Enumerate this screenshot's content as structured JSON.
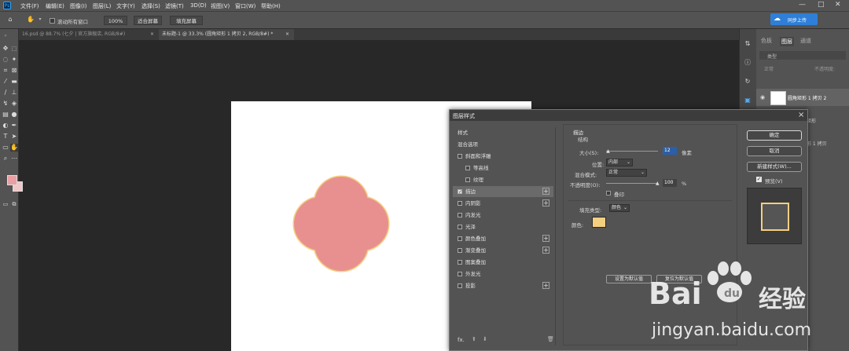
{
  "menubar": {
    "logo": "Ps",
    "items": [
      "文件(F)",
      "编辑(E)",
      "图像(I)",
      "图层(L)",
      "文字(Y)",
      "选择(S)",
      "滤镜(T)",
      "3D(D)",
      "视图(V)",
      "窗口(W)",
      "帮助(H)"
    ],
    "minimize": "—",
    "maximize": "□",
    "close": "✕",
    "cloud_button": "同步上传"
  },
  "options": {
    "scroll_all_windows": "滚动所有窗口",
    "zoom_100": "100%",
    "fit_screen": "适合屏幕",
    "fill_screen": "填充屏幕"
  },
  "tabs": [
    {
      "label": "16.psd @ 88.7% (七夕 | 官方旗舰店, RGB/8#)",
      "close": "×"
    },
    {
      "label": "未标题-1 @ 33.3% (圆角矩形 1 拷贝 2, RGB/8#) *",
      "close": "×"
    }
  ],
  "panel": {
    "tabs": [
      "色板",
      "图层",
      "通道"
    ],
    "kind_label": "类型",
    "blend_label": "正常",
    "opacity_label": "不透明度:",
    "layers": [
      "圆角矩形 1 拷贝 2",
      "矩形",
      "形 1 拷贝"
    ]
  },
  "dialog": {
    "title": "图层样式",
    "close": "×",
    "style_list": [
      {
        "label": "样式",
        "checkbox": false,
        "plus": false
      },
      {
        "label": "混合选项",
        "checkbox": false,
        "plus": false
      },
      {
        "label": "斜面和浮雕",
        "checkbox": true,
        "checked": false,
        "plus": false
      },
      {
        "label": "等高线",
        "checkbox": true,
        "checked": false,
        "plus": false,
        "indent": true
      },
      {
        "label": "纹理",
        "checkbox": true,
        "checked": false,
        "plus": false,
        "indent": true
      },
      {
        "label": "描边",
        "checkbox": true,
        "checked": true,
        "plus": true,
        "active": true
      },
      {
        "label": "内阴影",
        "checkbox": true,
        "checked": false,
        "plus": true
      },
      {
        "label": "内发光",
        "checkbox": true,
        "checked": false,
        "plus": false
      },
      {
        "label": "光泽",
        "checkbox": true,
        "checked": false,
        "plus": false
      },
      {
        "label": "颜色叠加",
        "checkbox": true,
        "checked": false,
        "plus": true
      },
      {
        "label": "渐变叠加",
        "checkbox": true,
        "checked": false,
        "plus": true
      },
      {
        "label": "图案叠加",
        "checkbox": true,
        "checked": false,
        "plus": false
      },
      {
        "label": "外发光",
        "checkbox": true,
        "checked": false,
        "plus": false
      },
      {
        "label": "投影",
        "checkbox": true,
        "checked": false,
        "plus": true
      }
    ],
    "footer_fx": "fx.",
    "section_title": "描边",
    "structure_label": "结构",
    "size_label": "大小(S):",
    "size_value": "12",
    "size_unit": "像素",
    "size_fraction": 0.05,
    "position_label": "位置:",
    "position_value": "内部",
    "blend_mode_label": "混合模式:",
    "blend_mode_value": "正常",
    "opacity_label": "不透明度(O):",
    "opacity_value": "100",
    "opacity_unit": "%",
    "opacity_fraction": 1.0,
    "overprint_label": "叠印",
    "fill_type_label": "填充类型:",
    "fill_type_value": "颜色",
    "color_label": "颜色:",
    "stroke_color": "#f5cf80",
    "set_default": "设置为默认值",
    "reset_default": "复位为默认值",
    "ok": "确定",
    "cancel": "取消",
    "new_style": "新建样式(W)...",
    "preview_label": "预览(V)"
  },
  "colors": {
    "shape_fill": "#e89090",
    "shape_stroke": "#f5cf80",
    "foreground": "#e8a0a5",
    "background": "#f0c7c8"
  },
  "watermark": {
    "brand": "Bai",
    "brand_suffix": "经验",
    "url": "jingyan.baidu.com"
  }
}
